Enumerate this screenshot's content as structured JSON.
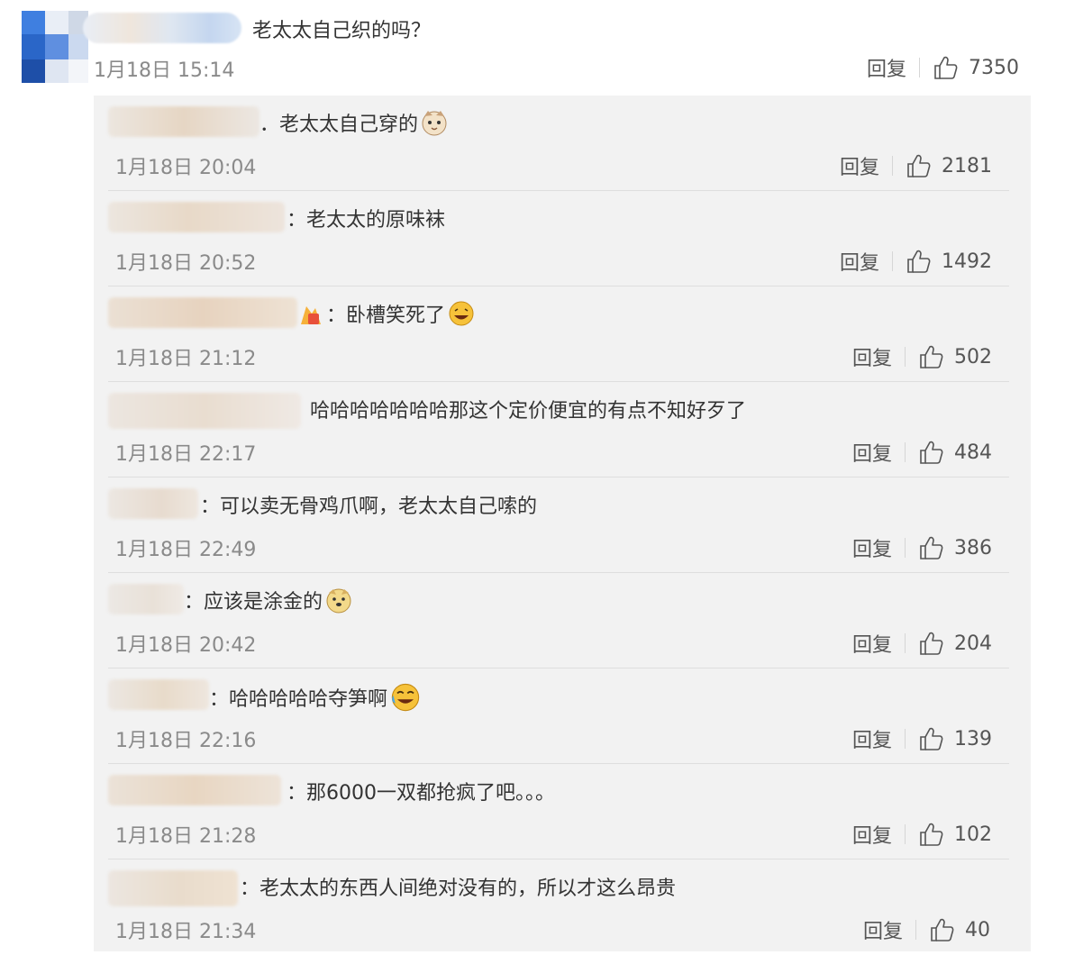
{
  "top_comment": {
    "text": "老太太自己织的吗？",
    "time": "1月18日 15:14",
    "reply_label": "回复",
    "likes": "7350"
  },
  "replies": [
    {
      "text": "．老太太自己穿的",
      "time": "1月18日 20:04",
      "reply_label": "回复",
      "likes": "2181",
      "emoji": "cat-face-icon"
    },
    {
      "text": "：老太太的原味袜",
      "time": "1月18日 20:52",
      "reply_label": "回复",
      "likes": "1492"
    },
    {
      "text": "：卧槽笑死了",
      "time": "1月18日 21:12",
      "reply_label": "回复",
      "likes": "502",
      "emoji": "laugh-icon"
    },
    {
      "text": "哈哈哈哈哈哈哈那这个定价便宜的有点不知好歹了",
      "time": "1月18日 22:17",
      "reply_label": "回复",
      "likes": "484"
    },
    {
      "text": "：可以卖无骨鸡爪啊，老太太自己嗦的",
      "time": "1月18日 22:49",
      "reply_label": "回复",
      "likes": "386"
    },
    {
      "text": "：应该是涂金的",
      "time": "1月18日 20:42",
      "reply_label": "回复",
      "likes": "204",
      "emoji": "doge-icon"
    },
    {
      "text": "：哈哈哈哈哈夺笋啊",
      "time": "1月18日 22:16",
      "reply_label": "回复",
      "likes": "139",
      "emoji": "tears-of-joy-icon"
    },
    {
      "text": "：那6000一双都抢疯了吧。。。",
      "time": "1月18日 21:28",
      "reply_label": "回复",
      "likes": "102"
    },
    {
      "text": "：老太太的东西人间绝对没有的，所以才这么昂贵",
      "time": "1月18日 21:34",
      "reply_label": "回复",
      "likes": "40"
    }
  ],
  "colors": {
    "panel_bg": "#f2f2f2",
    "time_gray": "#8a8a8a",
    "text_dark": "#333333",
    "divider": "#dedede"
  }
}
